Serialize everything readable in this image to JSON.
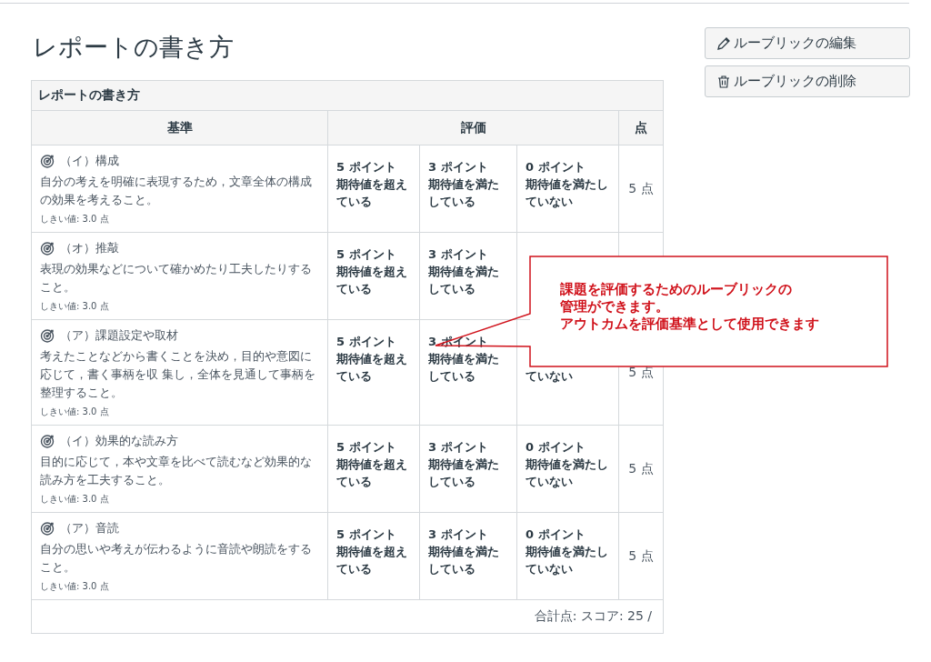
{
  "title": "レポートの書き方",
  "buttons": [
    {
      "kind": "edit",
      "label": "ルーブリックの編集"
    },
    {
      "kind": "delete",
      "label": "ルーブリックの削除"
    }
  ],
  "rubric": {
    "caption": "レポートの書き方",
    "columns": [
      "基準",
      "評価",
      "点"
    ],
    "rows": [
      {
        "criterion": "（イ）構成",
        "description": "自分の考えを明確に表現するため，文章全体の構成の効果を考えること。",
        "threshold": "しきい値: 3.0 点",
        "ratings": [
          {
            "kind": "full",
            "points": "5 ポイント",
            "description": "期待値を超えている"
          },
          {
            "kind": "full",
            "points": "3 ポイント",
            "description": "期待値を満たしている"
          },
          {
            "kind": "full",
            "points": "0 ポイント",
            "description": "期待値を満たしていない"
          }
        ],
        "score": "5 点"
      },
      {
        "criterion": "（オ）推敲",
        "description": "表現の効果などについて確かめたり工夫したりすること。",
        "threshold": "しきい値: 3.0 点",
        "ratings": [
          {
            "kind": "full",
            "points": "5 ポイント",
            "description": "期待値を超えている"
          },
          {
            "kind": "full",
            "points": "3 ポイント",
            "description": "期待値を満たしている"
          },
          {
            "kind": "covered"
          }
        ]
      },
      {
        "criterion": "（ア）課題設定や取材",
        "description": "考えたことなどから書くことを決め，目的や意図に応じて，書く事柄を収 集し，全体を見通して事柄を整理すること。",
        "threshold": "しきい値: 3.0 点",
        "ratings": [
          {
            "kind": "full",
            "points": "5 ポイント",
            "description": "期待値を超えている"
          },
          {
            "kind": "full",
            "points": "3 ポイント",
            "description": "期待値を満たしている"
          },
          {
            "kind": "covered",
            "description": "ていない"
          }
        ],
        "score": "5 点"
      },
      {
        "criterion": "（イ）効果的な読み方",
        "description": "目的に応じて，本や文章を比べて読むなど効果的な読み方を工夫すること。",
        "threshold": "しきい値: 3.0 点",
        "ratings": [
          {
            "kind": "full",
            "points": "5 ポイント",
            "description": "期待値を超えている"
          },
          {
            "kind": "full",
            "points": "3 ポイント",
            "description": "期待値を満たしている"
          },
          {
            "kind": "full",
            "points": "0 ポイント",
            "description": "期待値を満たしていない"
          }
        ],
        "score": "5 点"
      },
      {
        "criterion": "（ア）音読",
        "description": "自分の思いや考えが伝わるように音読や朗読をすること。",
        "threshold": "しきい値: 3.0 点",
        "ratings": [
          {
            "kind": "full",
            "points": "5 ポイント",
            "description": "期待値を超えている"
          },
          {
            "kind": "full",
            "points": "3 ポイント",
            "description": "期待値を満たしている"
          },
          {
            "kind": "full",
            "points": "0 ポイント",
            "description": "期待値を満たしていない"
          }
        ],
        "score": "5 点"
      }
    ],
    "total": "合計点: スコア: 25 /"
  },
  "callout": {
    "lines": [
      "課題を評価するためのルーブリックの",
      "管理ができます。",
      "アウトカムを評価基準として使用できます"
    ]
  }
}
